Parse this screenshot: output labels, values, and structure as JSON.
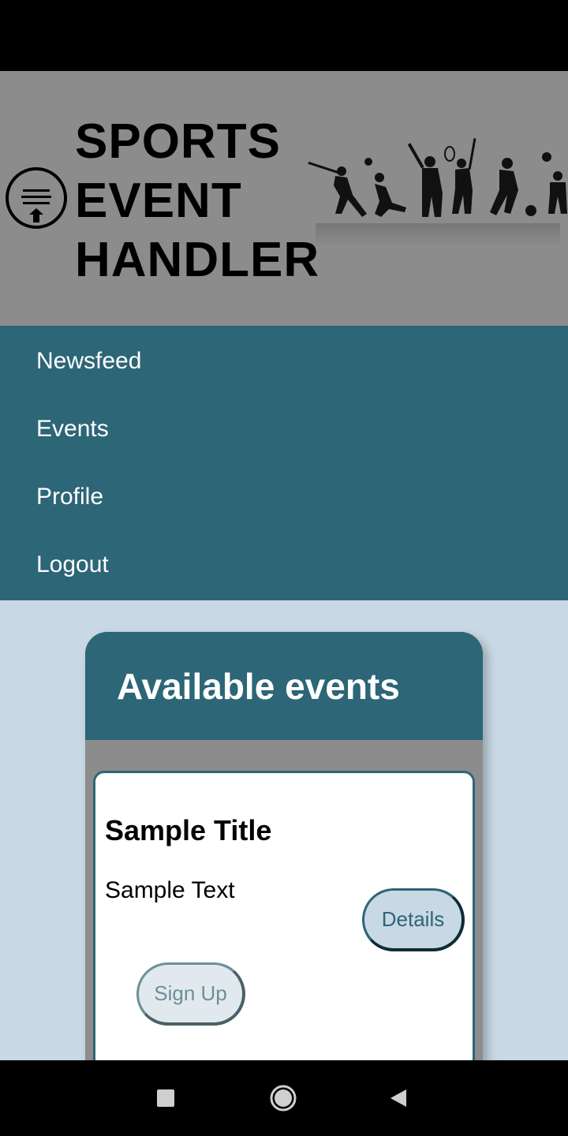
{
  "header": {
    "title_lines": [
      "SPORTS",
      "EVENT",
      "HANDLER"
    ],
    "menu_icon": "menu-upload-icon",
    "banner_image": "sports-silhouettes"
  },
  "nav": {
    "items": [
      {
        "label": "Newsfeed"
      },
      {
        "label": "Events"
      },
      {
        "label": "Profile"
      },
      {
        "label": "Logout"
      }
    ]
  },
  "events": {
    "title": "Available events",
    "cards": [
      {
        "title": "Sample Title",
        "text": "Sample Text",
        "details_label": "Details",
        "signup_label": "Sign Up"
      }
    ]
  },
  "system_nav": {
    "icons": [
      "recents-icon",
      "home-icon",
      "back-icon"
    ]
  },
  "colors": {
    "primary": "#2c6677",
    "header_bg": "#8c8c8c",
    "content_bg": "#c8d8e4"
  }
}
